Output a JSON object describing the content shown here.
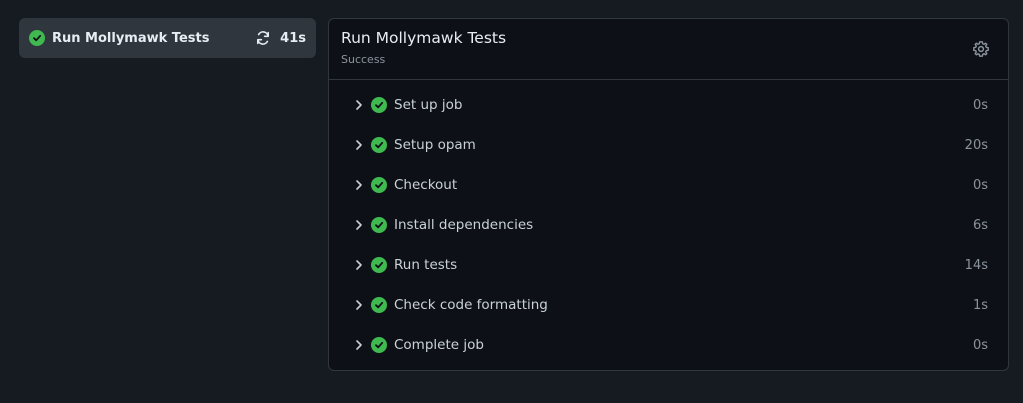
{
  "sidebar": {
    "job": {
      "label": "Run Mollymawk Tests",
      "duration": "41s",
      "status_icon": "check-circle-icon",
      "rerun_icon": "sync-icon"
    }
  },
  "panel": {
    "title": "Run Mollymawk Tests",
    "status": "Success",
    "settings_icon": "gear-icon",
    "steps": [
      {
        "label": "Set up job",
        "duration": "0s"
      },
      {
        "label": "Setup opam",
        "duration": "20s"
      },
      {
        "label": "Checkout",
        "duration": "0s"
      },
      {
        "label": "Install dependencies",
        "duration": "6s"
      },
      {
        "label": "Run tests",
        "duration": "14s"
      },
      {
        "label": "Check code formatting",
        "duration": "1s"
      },
      {
        "label": "Complete job",
        "duration": "0s"
      }
    ]
  },
  "colors": {
    "background": "#161b22",
    "panel": "#0d1117",
    "success": "#3fb950",
    "sidebar_selected": "#30363d"
  }
}
